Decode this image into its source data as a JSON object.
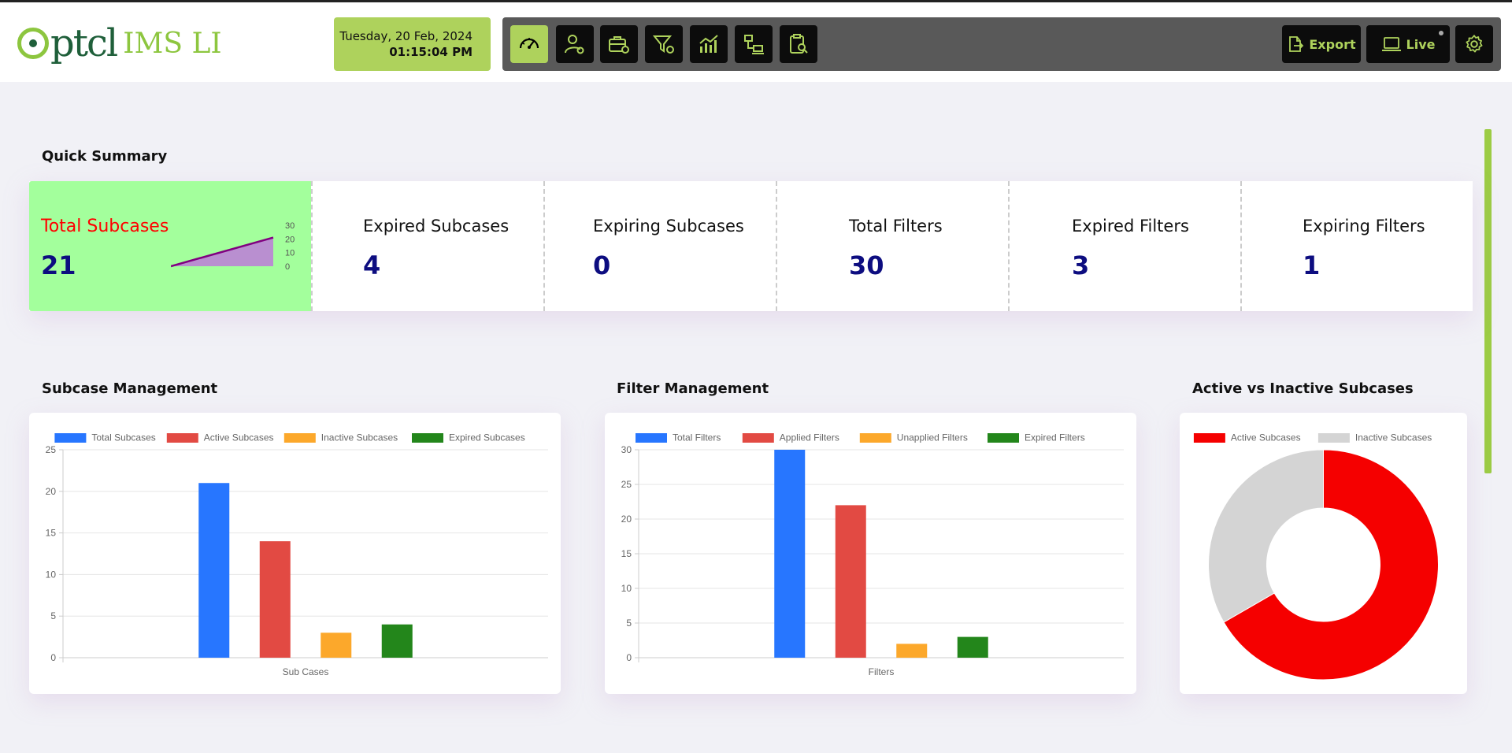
{
  "header": {
    "logo": {
      "brand": "ptcl",
      "product": "IMS LI"
    },
    "date": "Tuesday, 20 Feb, 2024",
    "time": "01:15:04 PM",
    "toolbar_icons": [
      "dashboard-gauge-icon",
      "user-settings-icon",
      "briefcase-settings-icon",
      "filter-settings-icon",
      "analytics-chart-icon",
      "network-devices-icon",
      "clipboard-search-icon"
    ],
    "export_label": "Export",
    "live_label": "Live",
    "settings_icon": "gear-icon",
    "colors": {
      "accent": "#aed25c",
      "toolbar": "#595959",
      "button": "#0c0c0c"
    }
  },
  "summary": {
    "title": "Quick Summary",
    "items": [
      {
        "label": "Total Subcases",
        "value": "21"
      },
      {
        "label": "Expired Subcases",
        "value": "4"
      },
      {
        "label": "Expiring Subcases",
        "value": "0"
      },
      {
        "label": "Total Filters",
        "value": "30"
      },
      {
        "label": "Expired Filters",
        "value": "3"
      },
      {
        "label": "Expiring Filters",
        "value": "1"
      }
    ],
    "sparkline": {
      "type": "area",
      "values": [
        0,
        21
      ],
      "y_ticks": [
        "30",
        "20",
        "10",
        "0"
      ],
      "ylim": [
        0,
        30
      ],
      "color": "#800080"
    }
  },
  "chart_data": [
    {
      "type": "bar",
      "title": "Subcase Management",
      "xlabel": "Sub Cases",
      "categories": [
        "Sub Cases"
      ],
      "series": [
        {
          "name": "Total Subcases",
          "values": [
            21
          ],
          "color": "#2776ff"
        },
        {
          "name": "Active Subcases",
          "values": [
            14
          ],
          "color": "#e24a43"
        },
        {
          "name": "Inactive Subcases",
          "values": [
            3
          ],
          "color": "#fca82b"
        },
        {
          "name": "Expired Subcases",
          "values": [
            4
          ],
          "color": "#23861b"
        }
      ],
      "ylim": [
        0,
        25
      ],
      "y_ticks": [
        0,
        5,
        10,
        15,
        20,
        25
      ],
      "grid": true,
      "legend": "top"
    },
    {
      "type": "bar",
      "title": "Filter Management",
      "xlabel": "Filters",
      "categories": [
        "Filters"
      ],
      "series": [
        {
          "name": "Total Filters",
          "values": [
            30
          ],
          "color": "#2776ff"
        },
        {
          "name": "Applied Filters",
          "values": [
            22
          ],
          "color": "#e24a43"
        },
        {
          "name": "Unapplied Filters",
          "values": [
            2
          ],
          "color": "#fca82b"
        },
        {
          "name": "Expired Filters",
          "values": [
            3
          ],
          "color": "#23861b"
        }
      ],
      "ylim": [
        0,
        30
      ],
      "y_ticks": [
        0,
        5,
        10,
        15,
        20,
        25,
        30
      ],
      "grid": true,
      "legend": "top"
    },
    {
      "type": "pie",
      "title": "Active vs Inactive Subcases",
      "donut": true,
      "labels": [
        "Active Subcases",
        "Inactive Subcases"
      ],
      "values": [
        14,
        7
      ],
      "colors": [
        "#f50000",
        "#d4d4d4"
      ],
      "legend": "top"
    }
  ]
}
